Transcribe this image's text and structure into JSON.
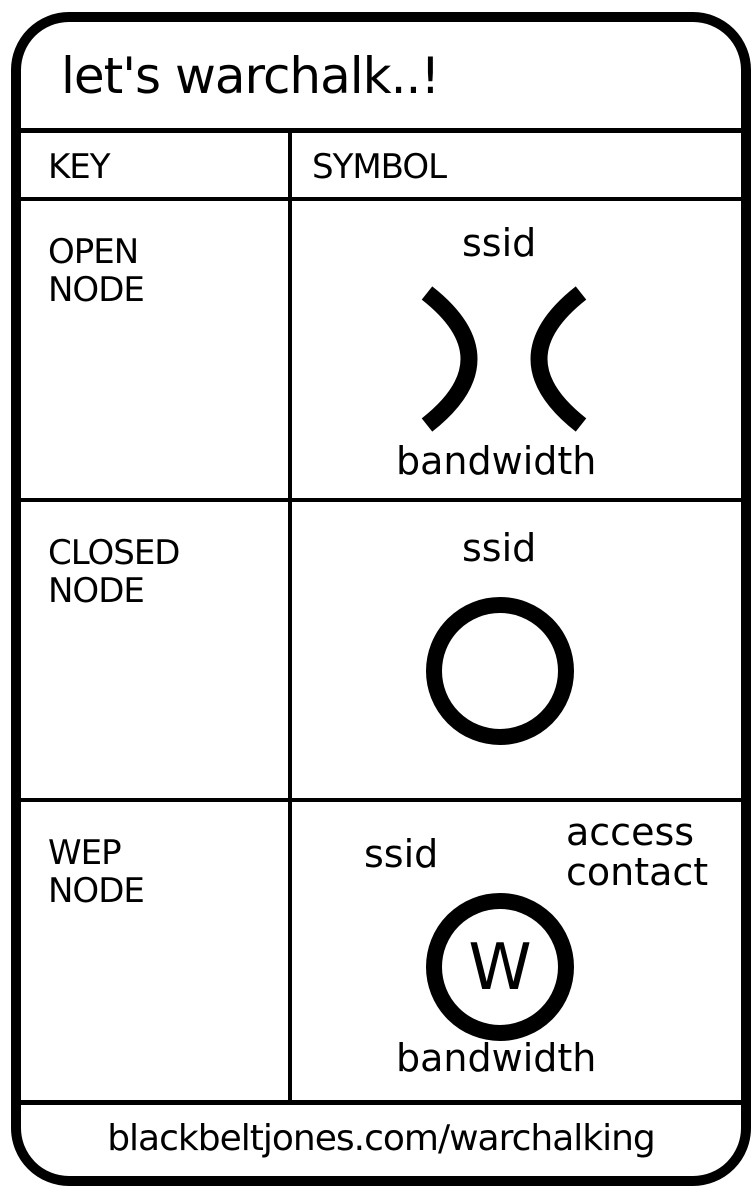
{
  "title": "let's warchalk..!",
  "headers": {
    "key": "KEY",
    "symbol": "SYMBOL"
  },
  "rows": [
    {
      "key_lines": [
        "OPEN",
        "NODE"
      ],
      "symbol_icon": "open-node-symbol",
      "labels": {
        "top": "ssid",
        "bottom": "bandwidth"
      }
    },
    {
      "key_lines": [
        "CLOSED",
        "NODE"
      ],
      "symbol_icon": "closed-node-symbol",
      "labels": {
        "top": "ssid"
      }
    },
    {
      "key_lines": [
        "WEP",
        "NODE"
      ],
      "symbol_icon": "wep-node-symbol",
      "symbol_letter": "W",
      "labels": {
        "left": "ssid",
        "right_line1": "access",
        "right_line2": "contact",
        "bottom": "bandwidth"
      }
    }
  ],
  "footer": "blackbeltjones.com/warchalking",
  "colors": {
    "ink": "#000000",
    "paper": "#ffffff"
  }
}
